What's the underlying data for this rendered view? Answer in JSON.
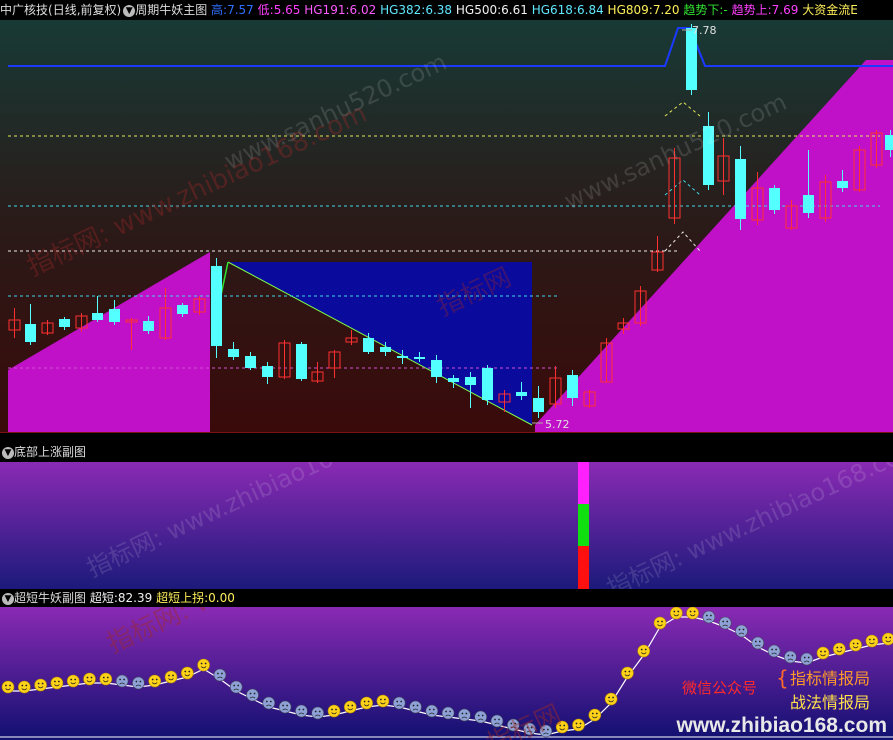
{
  "main": {
    "stock": "中广核技",
    "mode": "(日线,前复权)",
    "indicator": "周期牛妖主图",
    "high_label": "高:",
    "high": "7.57",
    "low_label": "低:",
    "low": "5.65",
    "hg191_label": "HG191:",
    "hg191": "6.02",
    "hg382_label": "HG382:",
    "hg382": "6.38",
    "hg500_label": "HG500:",
    "hg500": "6.61",
    "hg618_label": "HG618:",
    "hg618": "6.84",
    "hg809_label": "HG809:",
    "hg809": "7.20",
    "down_label": "趋势下:",
    "down": "-",
    "up_label": "趋势上:",
    "up": "7.69",
    "fund_label": "大资金流E",
    "peak_label": "7.78",
    "trough_label": "5.72"
  },
  "sub1": {
    "title": "底部上涨副图"
  },
  "sub2": {
    "title": "超短牛妖副图",
    "super_label": "超短:",
    "super": "82.39",
    "inflect_label": "超短上拐:",
    "inflect": "0.00"
  },
  "watermarks": {
    "a": "指标网: www.zhibiao168.com",
    "b": "www.sanhu520.com",
    "c": "指标网"
  },
  "promo": {
    "wechat": "微信公众号",
    "line1": "指标情报局",
    "line2": "战法情报局",
    "url": "www.zhibiao168.com"
  },
  "colors": {
    "up_candle": "#ff3030",
    "down_candle": "#54ffff",
    "fill_magenta": "#c010c8",
    "fill_blue": "#0a0a9c",
    "trend_line": "#1a3aff"
  }
}
